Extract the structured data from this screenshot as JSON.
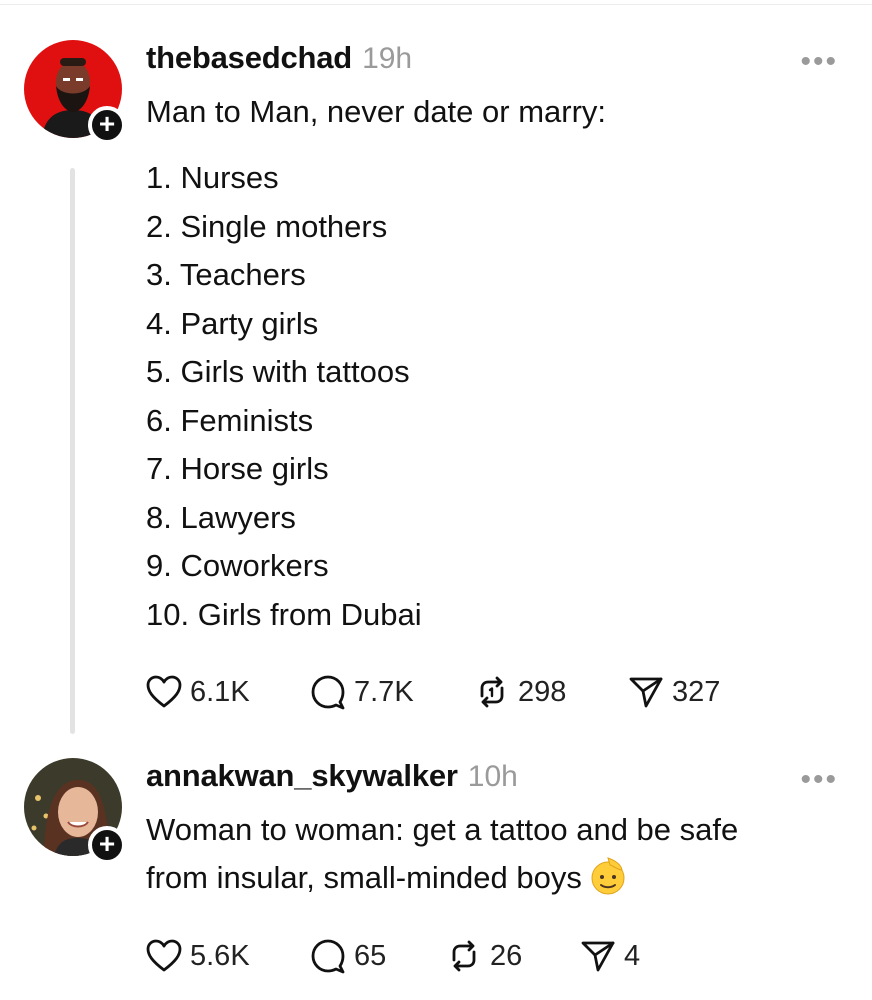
{
  "posts": [
    {
      "username": "thebasedchad",
      "time": "19h",
      "text": "Man to Man, never date or marry:",
      "list": [
        "1. Nurses",
        "2. Single mothers",
        "3. Teachers",
        "4. Party girls",
        "5. Girls with tattoos",
        "6. Feminists",
        "7. Horse girls",
        "8. Lawyers",
        "9. Coworkers",
        "10. Girls from Dubai"
      ],
      "likes": "6.1K",
      "replies": "7.7K",
      "reposts": "298",
      "shares": "327",
      "avatar_color": "#e01010"
    },
    {
      "username": "annakwan_skywalker",
      "time": "10h",
      "text_line1": "Woman to woman: get a tattoo and be safe",
      "text_line2": "from insular, small-minded boys",
      "emoji": "saluting-face-emoji",
      "likes": "5.6K",
      "replies": "65",
      "reposts": "26",
      "shares": "4"
    }
  ],
  "ui": {
    "follow_symbol": "+",
    "more_symbol": "•••"
  }
}
